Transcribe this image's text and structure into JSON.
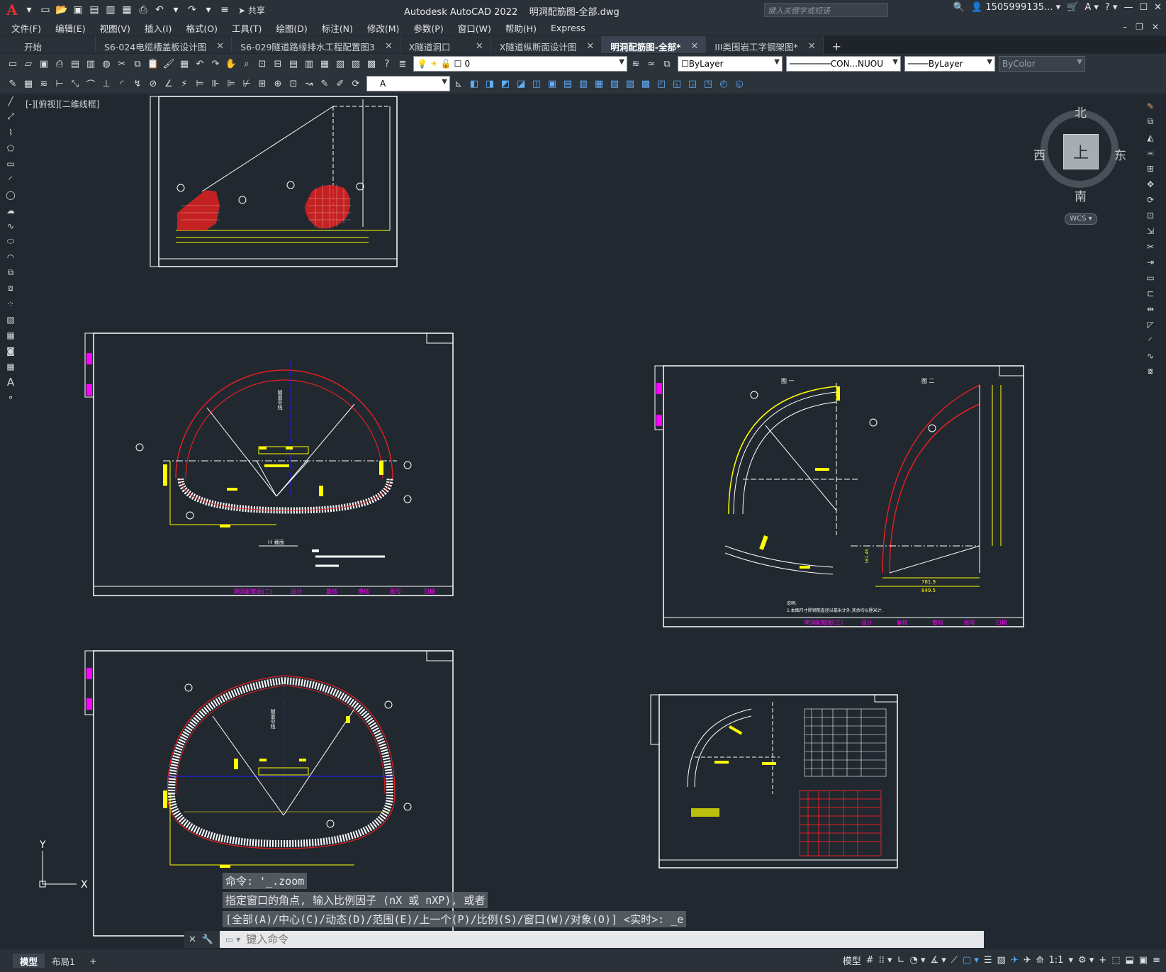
{
  "title_bar": {
    "app_name": "Autodesk AutoCAD 2022",
    "file_name": "明洞配筋图-全部.dwg",
    "share_label": "共享",
    "search_placeholder": "键入关键字或短语",
    "user": "1505999135..."
  },
  "menu": {
    "items": [
      "文件(F)",
      "编辑(E)",
      "视图(V)",
      "插入(I)",
      "格式(O)",
      "工具(T)",
      "绘图(D)",
      "标注(N)",
      "修改(M)",
      "参数(P)",
      "窗口(W)",
      "帮助(H)",
      "Express"
    ]
  },
  "tabs": [
    {
      "label": "开始",
      "active": false
    },
    {
      "label": "S6-024电缆槽盖板设计图",
      "active": false
    },
    {
      "label": "S6-029隧道路缘排水工程配置图3",
      "active": false
    },
    {
      "label": "X隧道洞口",
      "active": false
    },
    {
      "label": "X隧道纵断面设计图",
      "active": false
    },
    {
      "label": "明洞配筋图-全部*",
      "active": true
    },
    {
      "label": "III类围岩工字钢架图*",
      "active": false
    }
  ],
  "properties": {
    "layer": "0",
    "color": "ByLayer",
    "linetype": "CON...NUOU",
    "lineweight": "ByLayer",
    "plotstyle": "ByColor",
    "text_style": "A"
  },
  "viewport_label": "[-][俯视][二维线框]",
  "viewcube": {
    "top_face": "上",
    "north": "北",
    "south": "南",
    "east": "东",
    "west": "西",
    "wcs": "WCS"
  },
  "command": {
    "history": [
      "命令: '_.zoom",
      "指定窗口的角点, 输入比例因子 (nX 或 nXP), 或者",
      "[全部(A)/中心(C)/动态(D)/范围(E)/上一个(P)/比例(S)/窗口(W)/对象(O)] <实时>: _e"
    ],
    "placeholder": "键入命令"
  },
  "drawing": {
    "sheet2_title": "明洞配筋图(二)",
    "sheet3_title": "明洞配筋图(三)",
    "sheet_design": "设计",
    "sheet_review": "复核",
    "sheet_check": "审核",
    "sheet_no": "图号",
    "sheet_date": "日期",
    "section_label": "I-I 截面",
    "center_line": "隧道中线",
    "detail1": "图 一",
    "detail2": "图 二",
    "dim_781": "781.9",
    "dim_849": "849.5",
    "dim_161": "161.45",
    "note": "说明:",
    "note_text": "1.本图尺寸除钢筋直径以毫米计外,其余均以厘米计.",
    "ucs_x": "X",
    "ucs_y": "Y"
  },
  "status": {
    "layout_tabs": [
      "模型",
      "布局1"
    ],
    "model_label": "模型",
    "scale": "1:1"
  },
  "colors": {
    "background": "#212830",
    "red": "#e02020",
    "yellow": "#ffff00",
    "magenta": "#ff00ff",
    "blue": "#2020ff",
    "white": "#ffffff"
  }
}
